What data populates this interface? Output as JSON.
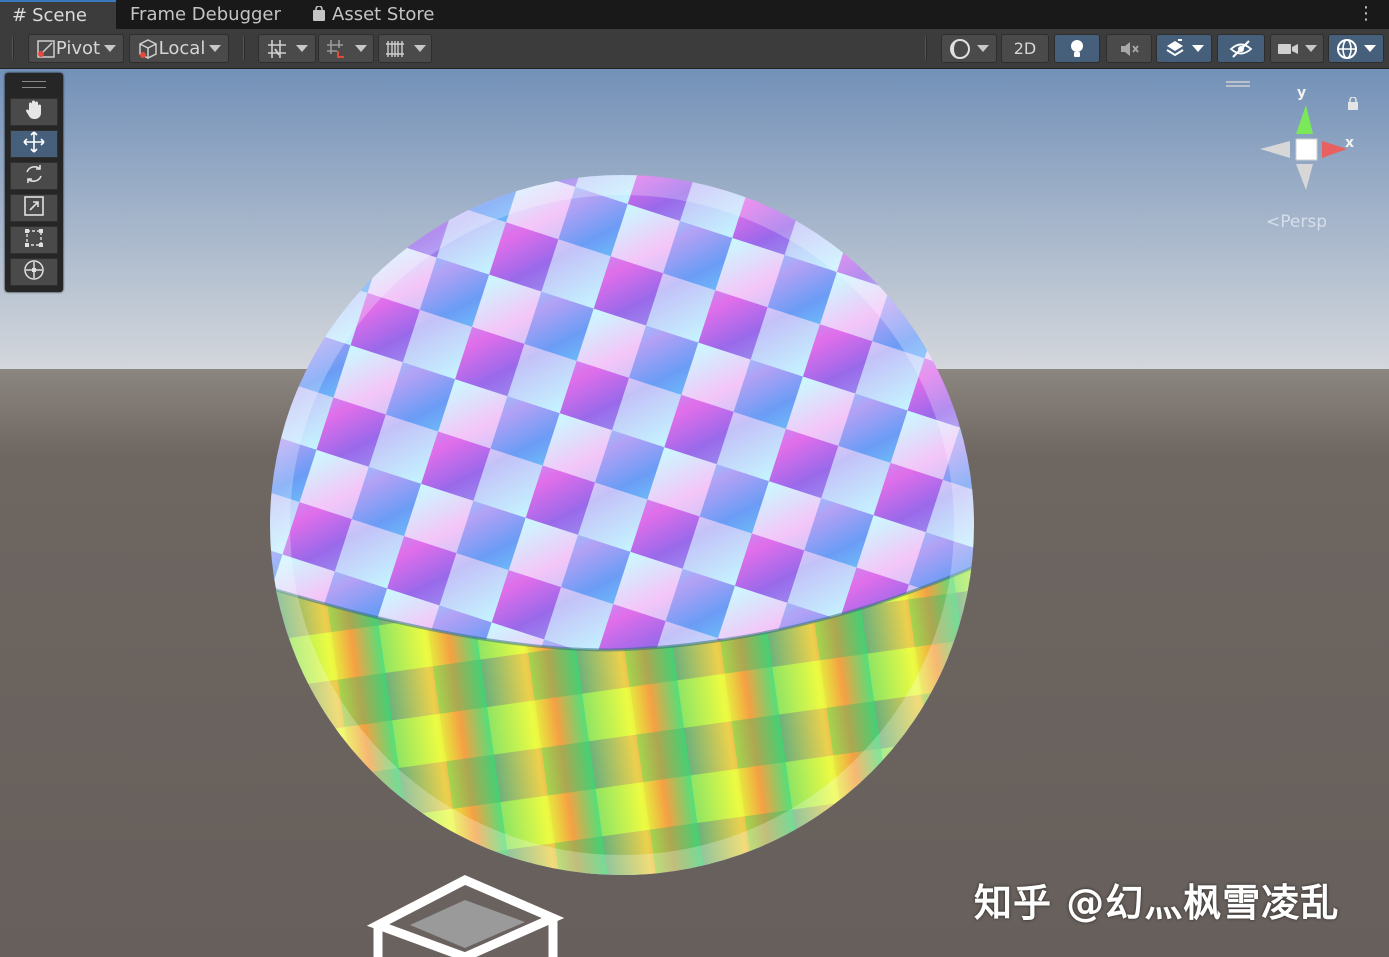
{
  "tabs": [
    {
      "label": "Scene",
      "icon": "scene-grid-icon",
      "active": true
    },
    {
      "label": "Frame Debugger",
      "icon": "",
      "active": false
    },
    {
      "label": "Asset Store",
      "icon": "asset-store-bag-icon",
      "active": false
    }
  ],
  "toolbar": {
    "pivot_label": "Pivot",
    "local_label": "Local",
    "mode_2d_label": "2D"
  },
  "gizmo": {
    "y_label": "y",
    "x_label": "x",
    "projection_label": "Persp",
    "lock_icon": "lock-icon"
  },
  "tools": [
    "hand-tool-icon",
    "move-tool-icon",
    "rotate-tool-icon",
    "scale-tool-icon",
    "rect-tool-icon",
    "transform-tool-icon"
  ],
  "watermark": "知乎 @幻灬枫雪凌乱",
  "colors": {
    "accent": "#3a79bb",
    "active_button": "#46607c",
    "sky_top": "#7d98bb",
    "horizon": "#c9ced6",
    "ground": "#6a625e"
  }
}
